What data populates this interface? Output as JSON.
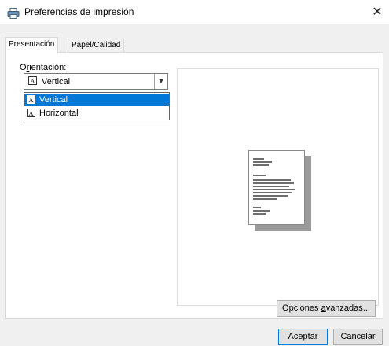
{
  "window": {
    "title": "Preferencias de impresión",
    "close_glyph": "✕"
  },
  "tabs": [
    {
      "label": "Presentación",
      "active": true
    },
    {
      "label": "Papel/Calidad",
      "active": false
    }
  ],
  "orientation": {
    "label_prefix": "O",
    "label_access_key": "r",
    "label_suffix": "ientación:",
    "selected": "Vertical",
    "options": [
      {
        "label": "Vertical",
        "icon_letter": "A",
        "selected": true
      },
      {
        "label": "Horizontal",
        "icon_letter": "A",
        "selected": false
      }
    ],
    "combo_icon_letter": "A"
  },
  "buttons": {
    "advanced_prefix": "Opciones ",
    "advanced_access_key": "a",
    "advanced_suffix": "vanzadas...",
    "accept": "Aceptar",
    "cancel": "Cancelar"
  },
  "colors": {
    "selection": "#0078d7",
    "dialog_bg": "#f0f0f0"
  },
  "icons": [
    "printer-icon",
    "close-icon",
    "chevron-down-icon",
    "letter-a-icon"
  ]
}
